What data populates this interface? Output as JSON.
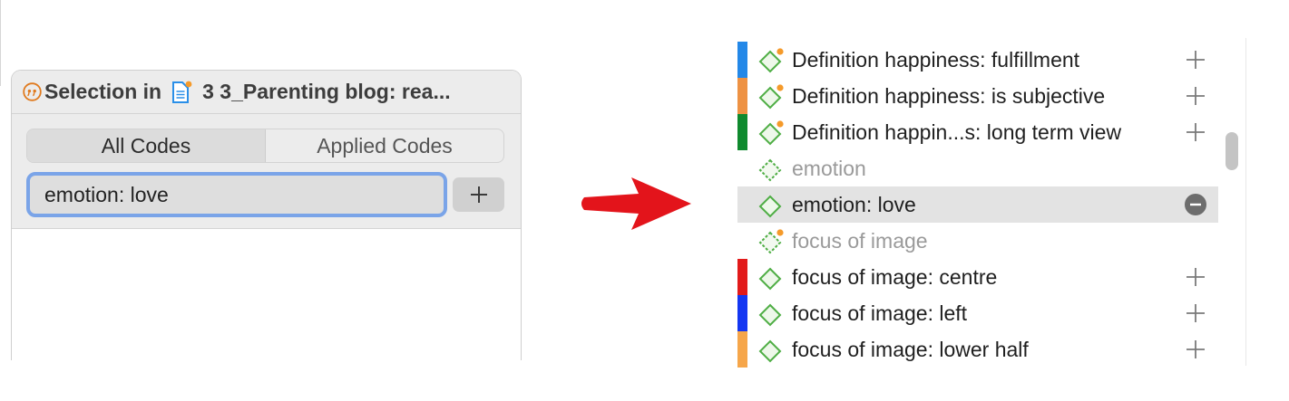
{
  "panel": {
    "header_title": "Selection in",
    "document_title": "3 3_Parenting blog: rea...",
    "tabs": [
      {
        "label": "All Codes",
        "selected": true
      },
      {
        "label": "Applied Codes",
        "selected": false
      }
    ],
    "search_value": "emotion: love",
    "add_button_icon": "plus-icon"
  },
  "arrow": {
    "color": "#e3141b",
    "icon": "right-arrow-icon"
  },
  "code_list": {
    "items": [
      {
        "label": "Definition happiness: fulfillment",
        "color": "#2388e8",
        "dim": false,
        "badge": true,
        "action": "plus"
      },
      {
        "label": "Definition happiness: is subjective",
        "color": "#ee9243",
        "dim": false,
        "badge": true,
        "action": "plus"
      },
      {
        "label": "Definition happin...s: long term view",
        "color": "#0f8a2e",
        "dim": false,
        "badge": true,
        "action": "plus"
      },
      {
        "label": "emotion",
        "color": null,
        "dim": true,
        "badge": false,
        "action": "none"
      },
      {
        "label": "emotion: love",
        "color": null,
        "dim": false,
        "badge": false,
        "action": "remove",
        "selected": true
      },
      {
        "label": "focus of image",
        "color": null,
        "dim": true,
        "badge": true,
        "action": "none"
      },
      {
        "label": "focus of image: centre",
        "color": "#e21a1a",
        "dim": false,
        "badge": false,
        "action": "plus"
      },
      {
        "label": "focus of image: left",
        "color": "#1437f2",
        "dim": false,
        "badge": false,
        "action": "plus"
      },
      {
        "label": "focus of image: lower half",
        "color": "#f6a64a",
        "dim": false,
        "badge": false,
        "action": "plus"
      }
    ]
  }
}
